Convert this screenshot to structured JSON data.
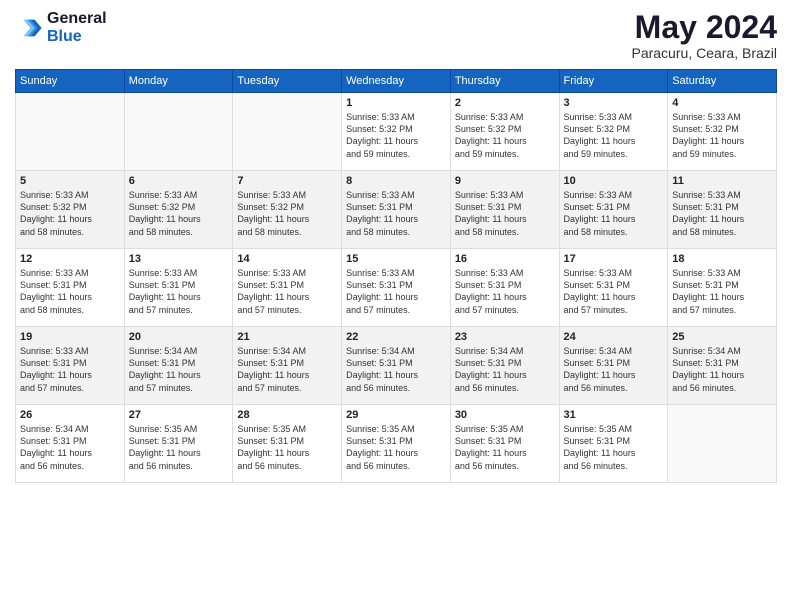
{
  "logo": {
    "line1": "General",
    "line2": "Blue"
  },
  "title": "May 2024",
  "subtitle": "Paracuru, Ceara, Brazil",
  "days_of_week": [
    "Sunday",
    "Monday",
    "Tuesday",
    "Wednesday",
    "Thursday",
    "Friday",
    "Saturday"
  ],
  "weeks": [
    [
      {
        "day": "",
        "info": ""
      },
      {
        "day": "",
        "info": ""
      },
      {
        "day": "",
        "info": ""
      },
      {
        "day": "1",
        "info": "Sunrise: 5:33 AM\nSunset: 5:32 PM\nDaylight: 11 hours\nand 59 minutes."
      },
      {
        "day": "2",
        "info": "Sunrise: 5:33 AM\nSunset: 5:32 PM\nDaylight: 11 hours\nand 59 minutes."
      },
      {
        "day": "3",
        "info": "Sunrise: 5:33 AM\nSunset: 5:32 PM\nDaylight: 11 hours\nand 59 minutes."
      },
      {
        "day": "4",
        "info": "Sunrise: 5:33 AM\nSunset: 5:32 PM\nDaylight: 11 hours\nand 59 minutes."
      }
    ],
    [
      {
        "day": "5",
        "info": "Sunrise: 5:33 AM\nSunset: 5:32 PM\nDaylight: 11 hours\nand 58 minutes."
      },
      {
        "day": "6",
        "info": "Sunrise: 5:33 AM\nSunset: 5:32 PM\nDaylight: 11 hours\nand 58 minutes."
      },
      {
        "day": "7",
        "info": "Sunrise: 5:33 AM\nSunset: 5:32 PM\nDaylight: 11 hours\nand 58 minutes."
      },
      {
        "day": "8",
        "info": "Sunrise: 5:33 AM\nSunset: 5:31 PM\nDaylight: 11 hours\nand 58 minutes."
      },
      {
        "day": "9",
        "info": "Sunrise: 5:33 AM\nSunset: 5:31 PM\nDaylight: 11 hours\nand 58 minutes."
      },
      {
        "day": "10",
        "info": "Sunrise: 5:33 AM\nSunset: 5:31 PM\nDaylight: 11 hours\nand 58 minutes."
      },
      {
        "day": "11",
        "info": "Sunrise: 5:33 AM\nSunset: 5:31 PM\nDaylight: 11 hours\nand 58 minutes."
      }
    ],
    [
      {
        "day": "12",
        "info": "Sunrise: 5:33 AM\nSunset: 5:31 PM\nDaylight: 11 hours\nand 58 minutes."
      },
      {
        "day": "13",
        "info": "Sunrise: 5:33 AM\nSunset: 5:31 PM\nDaylight: 11 hours\nand 57 minutes."
      },
      {
        "day": "14",
        "info": "Sunrise: 5:33 AM\nSunset: 5:31 PM\nDaylight: 11 hours\nand 57 minutes."
      },
      {
        "day": "15",
        "info": "Sunrise: 5:33 AM\nSunset: 5:31 PM\nDaylight: 11 hours\nand 57 minutes."
      },
      {
        "day": "16",
        "info": "Sunrise: 5:33 AM\nSunset: 5:31 PM\nDaylight: 11 hours\nand 57 minutes."
      },
      {
        "day": "17",
        "info": "Sunrise: 5:33 AM\nSunset: 5:31 PM\nDaylight: 11 hours\nand 57 minutes."
      },
      {
        "day": "18",
        "info": "Sunrise: 5:33 AM\nSunset: 5:31 PM\nDaylight: 11 hours\nand 57 minutes."
      }
    ],
    [
      {
        "day": "19",
        "info": "Sunrise: 5:33 AM\nSunset: 5:31 PM\nDaylight: 11 hours\nand 57 minutes."
      },
      {
        "day": "20",
        "info": "Sunrise: 5:34 AM\nSunset: 5:31 PM\nDaylight: 11 hours\nand 57 minutes."
      },
      {
        "day": "21",
        "info": "Sunrise: 5:34 AM\nSunset: 5:31 PM\nDaylight: 11 hours\nand 57 minutes."
      },
      {
        "day": "22",
        "info": "Sunrise: 5:34 AM\nSunset: 5:31 PM\nDaylight: 11 hours\nand 56 minutes."
      },
      {
        "day": "23",
        "info": "Sunrise: 5:34 AM\nSunset: 5:31 PM\nDaylight: 11 hours\nand 56 minutes."
      },
      {
        "day": "24",
        "info": "Sunrise: 5:34 AM\nSunset: 5:31 PM\nDaylight: 11 hours\nand 56 minutes."
      },
      {
        "day": "25",
        "info": "Sunrise: 5:34 AM\nSunset: 5:31 PM\nDaylight: 11 hours\nand 56 minutes."
      }
    ],
    [
      {
        "day": "26",
        "info": "Sunrise: 5:34 AM\nSunset: 5:31 PM\nDaylight: 11 hours\nand 56 minutes."
      },
      {
        "day": "27",
        "info": "Sunrise: 5:35 AM\nSunset: 5:31 PM\nDaylight: 11 hours\nand 56 minutes."
      },
      {
        "day": "28",
        "info": "Sunrise: 5:35 AM\nSunset: 5:31 PM\nDaylight: 11 hours\nand 56 minutes."
      },
      {
        "day": "29",
        "info": "Sunrise: 5:35 AM\nSunset: 5:31 PM\nDaylight: 11 hours\nand 56 minutes."
      },
      {
        "day": "30",
        "info": "Sunrise: 5:35 AM\nSunset: 5:31 PM\nDaylight: 11 hours\nand 56 minutes."
      },
      {
        "day": "31",
        "info": "Sunrise: 5:35 AM\nSunset: 5:31 PM\nDaylight: 11 hours\nand 56 minutes."
      },
      {
        "day": "",
        "info": ""
      }
    ]
  ]
}
